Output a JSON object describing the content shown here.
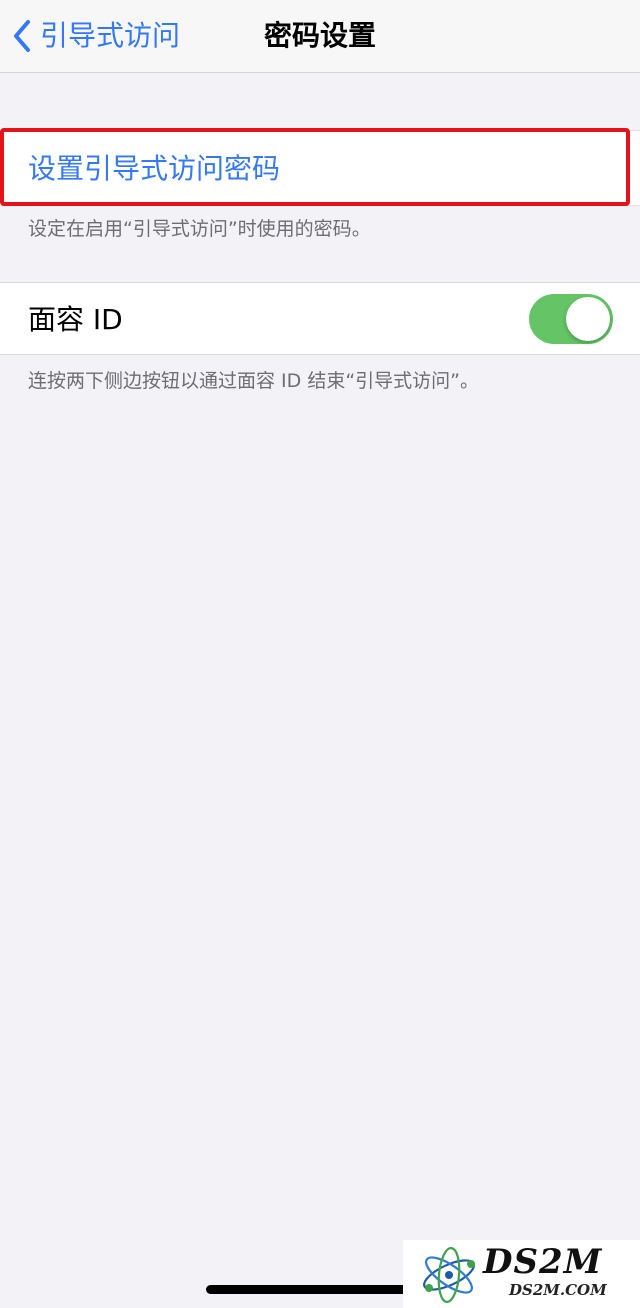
{
  "nav": {
    "back_label": "引导式访问",
    "title": "密码设置"
  },
  "passcode_section": {
    "set_passcode_label": "设置引导式访问密码",
    "footer": "设定在启用“引导式访问”时使用的密码。"
  },
  "faceid_section": {
    "label": "面容 ID",
    "toggle_on": true,
    "footer": "连按两下侧边按钮以通过面容 ID 结束“引导式访问”。"
  },
  "watermark": {
    "brand": "DS2M",
    "url": "DS2M.COM"
  },
  "colors": {
    "accent": "#3478F6",
    "toggle_on": "#65C466",
    "highlight": "#E2131B",
    "background": "#F2F2F7"
  }
}
